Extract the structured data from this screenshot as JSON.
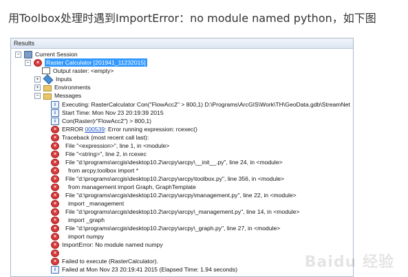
{
  "heading": "用Toolbox处理时遇到ImportError：no module named python，如下图",
  "panel_title": "Results",
  "tree": {
    "session": "Current Session",
    "tool": "Raster Calculator [201941_11232015]",
    "output": "Output raster: <empty>",
    "inputs": "Inputs",
    "environments": "Environments",
    "messages_label": "Messages",
    "executing": "Executing: RasterCalculator Con(\"FlowAcc2\" > 800,1) D:\\Programs\\ArcGIS\\Work\\TH\\GeoData.gdb\\StreamNet",
    "start_time": "Start Time: Mon Nov 23 20:19:39 2015",
    "con": "Con(Raster(r\"FlowAcc2\") > 800,1)",
    "error_prefix": "ERROR ",
    "error_code": "000539",
    "error_suffix": ": Error running expression: rcexec()",
    "traceback": "Traceback (most recent call last):",
    "lines": [
      "File \"<expression>\", line 1, in <module>",
      "File \"<string>\", line 2, in rcexec",
      "File \"d:\\programs\\arcgis\\desktop10.2\\arcpy\\arcpy\\__init__.py\", line 24, in <module>",
      "from arcpy.toolbox import *",
      "File \"d:\\programs\\arcgis\\desktop10.2\\arcpy\\arcpy\\toolbox.py\", line 356, in <module>",
      "from management import Graph, GraphTemplate",
      "File \"d:\\programs\\arcgis\\desktop10.2\\arcpy\\arcpy\\management.py\", line 22, in <module>",
      "import _management",
      "File \"d:\\programs\\arcgis\\desktop10.2\\arcpy\\arcpy\\_management.py\", line 14, in <module>",
      "import _graph",
      "File \"d:\\programs\\arcgis\\desktop10.2\\arcpy\\arcpy\\_graph.py\", line 27, in <module>",
      "import numpy"
    ],
    "import_error": "ImportError: No module named numpy",
    "failed": "Failed to execute (RasterCalculator).",
    "failed_at": "Failed at Mon Nov 23 20:19:41 2015 (Elapsed Time: 1.94 seconds)"
  },
  "toggles": {
    "expanded": "−",
    "collapsed": "+"
  },
  "icons": {
    "error": "error-icon",
    "info": "info-icon"
  },
  "watermark": "Baidu 经验"
}
